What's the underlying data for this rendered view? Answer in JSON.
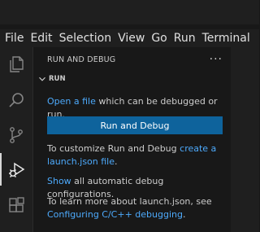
{
  "menu": [
    "File",
    "Edit",
    "Selection",
    "View",
    "Go",
    "Run",
    "Terminal"
  ],
  "activity": [
    {
      "icon": "files-icon"
    },
    {
      "icon": "search-icon"
    },
    {
      "icon": "source-control-icon"
    },
    {
      "icon": "run-debug-icon",
      "active": true
    },
    {
      "icon": "extensions-icon"
    }
  ],
  "sidebar": {
    "title": "RUN AND DEBUG",
    "more": "···",
    "section": "RUN",
    "open_file_link": "Open a file",
    "open_file_rest": " which can be debugged or run.",
    "run_button": "Run and Debug",
    "customize_prefix": "To customize Run and Debug ",
    "customize_link": "create a launch.json file",
    "customize_suffix": ".",
    "show_link": "Show",
    "show_rest": " all automatic debug configurations.",
    "learn_prefix": "To learn more about launch.json, see ",
    "learn_link": "Configuring C/C++ debugging",
    "learn_suffix": "."
  },
  "colors": {
    "accent_button": "#0e639c",
    "link": "#4daafc",
    "background": "#181818"
  }
}
